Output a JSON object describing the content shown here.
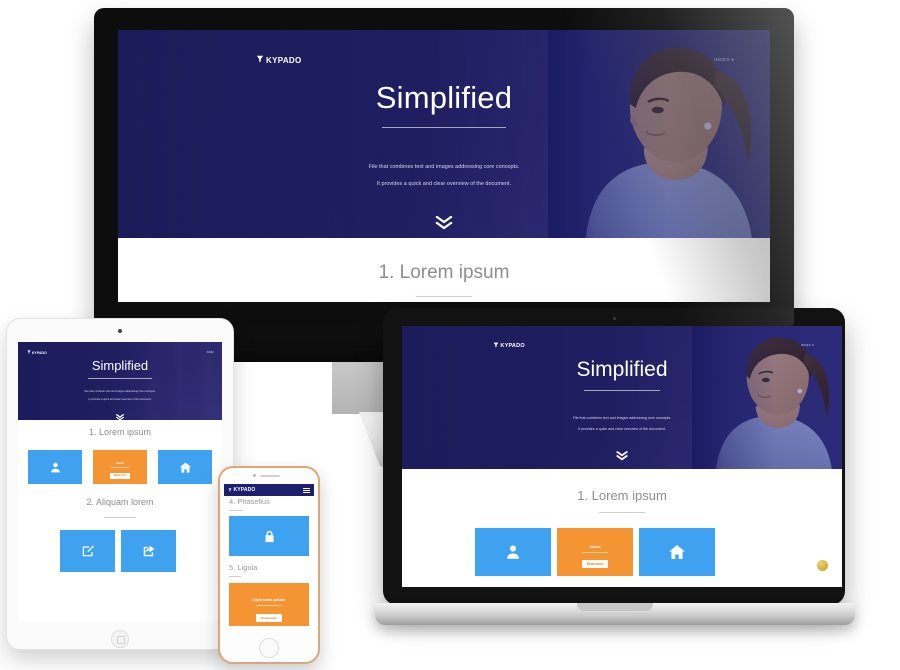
{
  "site": {
    "brand": "KYPADO",
    "nav": "INDEX",
    "hero": {
      "title": "Simplified",
      "sub1": "File that combines text and images addressing core concepts.",
      "sub2": "It provides a quick and clear overview of the document.",
      "scroll_icon": "chevron-double-down-icon"
    },
    "sections": [
      {
        "num": "1",
        "title": "1. Lorem ipsum"
      },
      {
        "num": "2",
        "title": "2. Aliquam lorem"
      },
      {
        "num": "4",
        "title": "4. Phasellus"
      },
      {
        "num": "5",
        "title": "5. Ligula"
      }
    ],
    "cards": {
      "person": {
        "icon": "person-icon",
        "color": "#3fa2f0"
      },
      "home": {
        "icon": "home-icon",
        "color": "#3fa2f0"
      },
      "edit": {
        "icon": "edit-pencil-icon",
        "color": "#3fa2f0"
      },
      "share": {
        "icon": "share-arrow-icon",
        "color": "#3fa2f0"
      },
      "lock": {
        "icon": "lock-icon",
        "color": "#3fa2f0"
      },
      "promo": {
        "title": "Autem",
        "button": "Read more",
        "color": "#f59432"
      },
      "promo_phone": {
        "title": "Ligula luctus pulvinar",
        "button": "Read more",
        "color": "#f59432"
      }
    },
    "badge": {
      "name": "gold-badge",
      "color": "#d4b138"
    }
  },
  "devices": {
    "desktop": "desktop-monitor",
    "laptop": "laptop",
    "tablet": "tablet",
    "phone": "phone"
  },
  "colors": {
    "hero_navy": "#1e1e6e",
    "card_blue": "#3fa2f0",
    "card_orange": "#f59432",
    "heading_grey": "#8d8d8d"
  }
}
